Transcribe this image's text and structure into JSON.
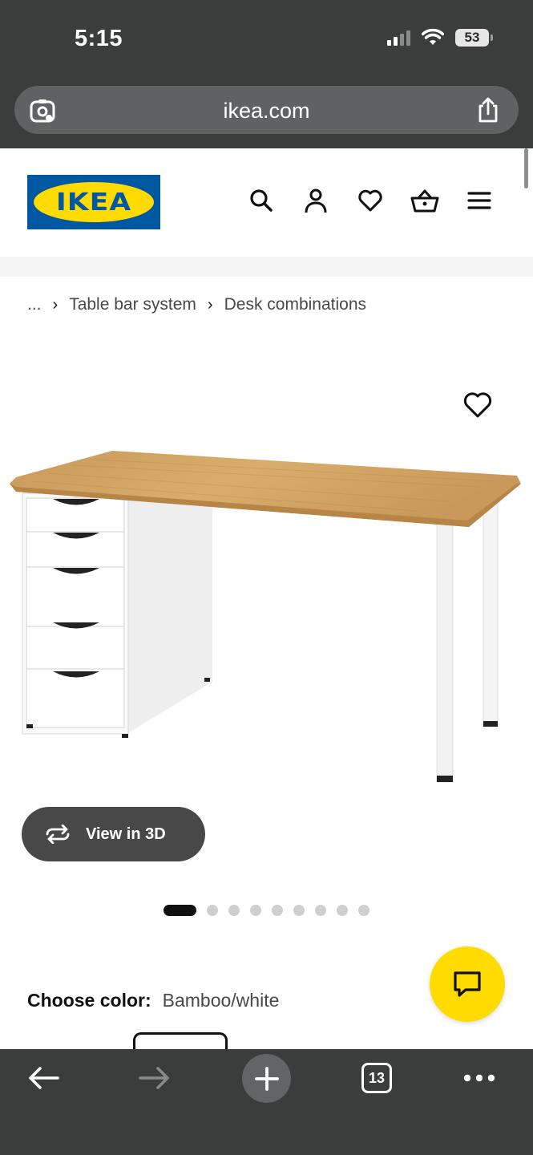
{
  "status_bar": {
    "time": "5:15",
    "battery": "53"
  },
  "browser": {
    "url": "ikea.com"
  },
  "header": {
    "logo_text": "IKEA",
    "brand_colors": {
      "blue": "#0058a3",
      "yellow": "#ffdb00"
    }
  },
  "breadcrumb": {
    "ellipsis": "...",
    "items": [
      "Table bar system",
      "Desk combinations"
    ]
  },
  "gallery": {
    "view_3d_label": "View in 3D",
    "image_count": 9,
    "active_index": 0
  },
  "color_choice": {
    "label": "Choose color:",
    "value": "Bamboo/white"
  },
  "toolbar": {
    "tabs_count": "13"
  }
}
